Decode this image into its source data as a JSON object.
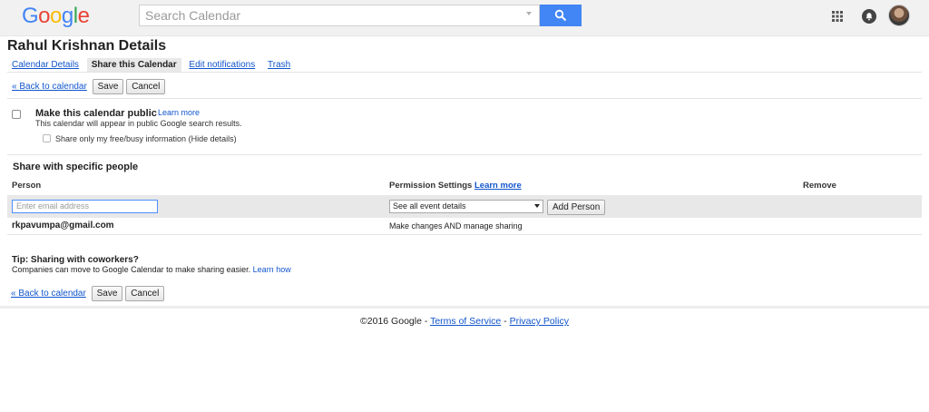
{
  "header": {
    "logo_letters": [
      {
        "char": "G",
        "color": "#4285f4"
      },
      {
        "char": "o",
        "color": "#ea4335"
      },
      {
        "char": "o",
        "color": "#fbbc05"
      },
      {
        "char": "g",
        "color": "#4285f4"
      },
      {
        "char": "l",
        "color": "#34a853"
      },
      {
        "char": "e",
        "color": "#ea4335"
      }
    ],
    "search_placeholder": "Search Calendar",
    "icons": [
      "search-icon",
      "apps-grid-icon",
      "notifications-icon",
      "avatar"
    ]
  },
  "page": {
    "title": "Rahul Krishnan Details",
    "tabs": [
      {
        "label": "Calendar Details",
        "active": false
      },
      {
        "label": "Share this Calendar",
        "active": true
      },
      {
        "label": "Edit notifications",
        "active": false
      },
      {
        "label": "Trash",
        "active": false
      }
    ]
  },
  "actions": {
    "back_link": "« Back to calendar",
    "save": "Save",
    "cancel": "Cancel"
  },
  "public": {
    "title": "Make this calendar public",
    "learn_more": "Learn more",
    "description": "This calendar will appear in public Google search results.",
    "freebusy_label": "Share only my free/busy information (Hide details)"
  },
  "share": {
    "title": "Share with specific people",
    "columns": {
      "person": "Person",
      "permission": "Permission Settings",
      "permission_learn_more": "Learn more",
      "remove": "Remove"
    },
    "email_placeholder": "Enter email address",
    "permission_selected": "See all event details",
    "add_person": "Add Person",
    "people": [
      {
        "email": "rkpavumpa@gmail.com",
        "permission": "Make changes AND manage sharing"
      }
    ]
  },
  "tip": {
    "title": "Tip: Sharing with coworkers?",
    "body": "Companies can move to Google Calendar to make sharing easier.",
    "link": "Learn how"
  },
  "footer": {
    "copyright": "©2016 Google - ",
    "terms": "Terms of Service",
    "separator": " - ",
    "privacy": "Privacy Policy"
  },
  "colors": {
    "accent_blue": "#4285f4",
    "link_blue": "#1155cc",
    "topbar_bg": "#f1f1f1",
    "row_bg": "#e8e8e8"
  }
}
